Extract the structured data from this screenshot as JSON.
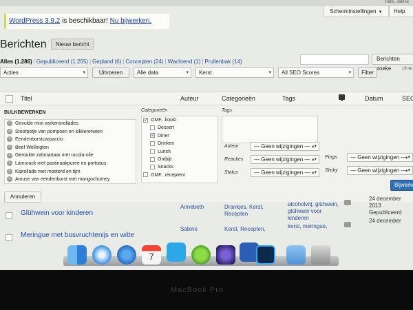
{
  "admin_bar": {
    "user_text": "Hallo, sabine"
  },
  "header": {
    "screen_options_label": "Scherminstellingen",
    "help_label": "Help",
    "notice_version": "WordPress 3.9.2",
    "notice_middle": " is beschikbaar! ",
    "notice_link": "Nu bijwerken."
  },
  "page": {
    "title": "Berichten",
    "new_post_label": "Nieuw bericht"
  },
  "status_filters": [
    {
      "label": "Alles",
      "count": "(1.286)"
    },
    {
      "label": "Gepubliceerd",
      "count": "(1.255)"
    },
    {
      "label": "Gepland",
      "count": "(6)"
    },
    {
      "label": "Concepten",
      "count": "(24)"
    },
    {
      "label": "Wachtend",
      "count": "(1)"
    },
    {
      "label": "Prullenbak",
      "count": "(14)"
    }
  ],
  "search": {
    "placeholder": "",
    "button_label": "Berichten zoeke"
  },
  "toolbar": {
    "bulk_action": "Acties",
    "apply_label": "Uitvoeren",
    "date_filter": "Alle data",
    "category_filter": "Kerst",
    "seo_filter": "All SEO Scores",
    "filter_label": "Filter",
    "items_count": "19 ite"
  },
  "table_head": {
    "title": "Titel",
    "author": "Auteur",
    "categories": "Categorieën",
    "tags": "Tags",
    "date": "Datum",
    "seo": "SEO"
  },
  "bulk_edit": {
    "heading": "BULKBEWERKEN",
    "items": [
      "Gevulde mini varkensrollades",
      "Stoofpotje van pompoen en kikkererwten",
      "Eendenborstcarpaccio",
      "Beef Wellington",
      "Gerookte zalmtartaar met rucola-olie",
      "Lamsrack met pastinaakpuree en portsaus",
      "Kiprollade met mosterd en tijm",
      "Amuse van eendenborst met mangochutney"
    ],
    "categories_heading": "Categorieën",
    "categories": [
      {
        "label": "OMF...kookt",
        "checked": true,
        "indent": false
      },
      {
        "label": "Dessert",
        "checked": false,
        "indent": true
      },
      {
        "label": "Diner",
        "checked": true,
        "indent": true
      },
      {
        "label": "Drinken",
        "checked": false,
        "indent": true
      },
      {
        "label": "Lunch",
        "checked": false,
        "indent": true
      },
      {
        "label": "Ontbijt",
        "checked": false,
        "indent": true
      },
      {
        "label": "Snacks",
        "checked": false,
        "indent": true
      },
      {
        "label": "OMF...receptent",
        "checked": false,
        "indent": false
      }
    ],
    "tags_heading": "Tags",
    "author_label": "Auteur",
    "reactions_label": "Reacties",
    "status_label": "Status",
    "pings_label": "Pings",
    "sticky_label": "Sticky",
    "no_change": "— Geen wijzigingen —",
    "update_label": "Bijwerken",
    "cancel_label": "Annuleren"
  },
  "posts": [
    {
      "title": "Glühwein voor kinderen",
      "author": "Annebeth",
      "categories": [
        "Drankjes, Kerst,",
        "Recepten"
      ],
      "tags": [
        "alcoholvrij, glühwein,",
        "glühwein voor",
        "kinderen"
      ],
      "date": [
        "24 december",
        "2013",
        "Gepubliceerd"
      ]
    },
    {
      "title": "Meringue met bosvruchtenijs en witte",
      "author": "Sabine",
      "categories": [
        "Kerst, Recepten,"
      ],
      "tags": [
        "kerst, meringue,"
      ],
      "date": [
        "24 december"
      ]
    }
  ],
  "bezel": {
    "brand": "MacBook Pro"
  },
  "dock": {
    "icons": [
      "finder-icon",
      "safari-icon",
      "app-store-icon",
      "calendar-icon",
      "twitter-icon",
      "utorrent-icon",
      "imovie-icon",
      "word-icon",
      "photoshop-icon",
      "folder-icon",
      "trash-icon"
    ],
    "calendar_day": "7"
  }
}
